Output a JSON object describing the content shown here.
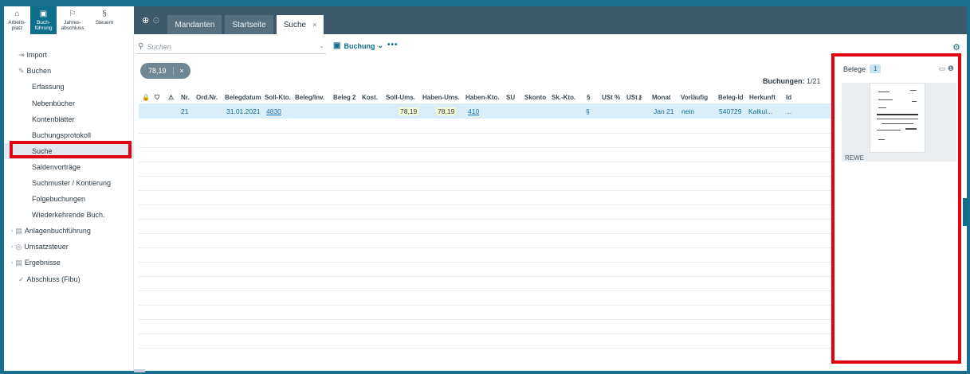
{
  "modules": [
    {
      "icon": "home-icon",
      "glyph": "⌂",
      "label_1": "Arbeits-",
      "label_2": "platz"
    },
    {
      "icon": "ledger-icon",
      "glyph": "▣",
      "label_1": "Buch-",
      "label_2": "führung"
    },
    {
      "icon": "flag-icon",
      "glyph": "⚐",
      "label_1": "Jahres-",
      "label_2": "abschluss"
    },
    {
      "icon": "paragraph-icon",
      "glyph": "§",
      "label_1": "Steuern",
      "label_2": ""
    }
  ],
  "tabs": [
    {
      "label": "Mandanten"
    },
    {
      "label": "Startseite"
    },
    {
      "label": "Suche",
      "close": "×"
    }
  ],
  "tabbar_icons": {
    "add": "⊕",
    "history": "⊙"
  },
  "sidebar": {
    "items": [
      {
        "label": "Import",
        "glyph": "⇥"
      },
      {
        "label": "Buchen",
        "glyph": "✎"
      },
      {
        "label": "Erfassung"
      },
      {
        "label": "Nebenbücher"
      },
      {
        "label": "Kontenblätter"
      },
      {
        "label": "Buchungsprotokoll"
      },
      {
        "label": "Suche"
      },
      {
        "label": "Saldenvorträge"
      },
      {
        "label": "Suchmuster / Kontierung"
      },
      {
        "label": "Folgebuchungen"
      },
      {
        "label": "Wiederkehrende Buch."
      },
      {
        "label": "Anlagenbuchführung",
        "glyph": "▤",
        "caret": "›"
      },
      {
        "label": "Umsatzsteuer",
        "glyph": "◎",
        "caret": "›"
      },
      {
        "label": "Ergebnisse",
        "glyph": "▤",
        "caret": "›"
      },
      {
        "label": "Abschluss (Fibu)",
        "glyph": "✓"
      }
    ]
  },
  "search": {
    "placeholder": "Suchen",
    "chevron": "⌄"
  },
  "toolbar": {
    "buchung_label": "Buchung",
    "buchung_chevron": "⌄",
    "more": "•••",
    "settings": "⚙"
  },
  "filter_chip": {
    "value": "78,19",
    "close": "×"
  },
  "count": {
    "label": "Buchungen:",
    "value": "1/21"
  },
  "table": {
    "header_icons": [
      "🔒",
      "⛉",
      "⚠"
    ],
    "columns": [
      "Nr.",
      "Ord.Nr.",
      "Belegdatum",
      "Soll-Kto.",
      "Beleg/Inv.",
      "Beleg 2",
      "Kost.",
      "Soll-Ums.",
      "Haben-Ums.",
      "Haben-Kto.",
      "SU",
      "Skonto",
      "Sk.-Kto.",
      "§",
      "USt %",
      "USt",
      "Monat",
      "Vorläufig",
      "Beleg-Id",
      "Herkunft",
      "Id"
    ],
    "rows": [
      {
        "nr": "21",
        "belegdatum": "31.01.2021",
        "soll_kto": "4830",
        "soll_ums": "78,19",
        "haben_ums": "78,19",
        "haben_kto": "410",
        "clip": "§",
        "monat": "Jan 21",
        "vorlaeufig": "nein",
        "beleg_id": "540729",
        "herkunft": "Kalkul...",
        "id": "..."
      }
    ]
  },
  "belege": {
    "title": "Belege",
    "count": "1",
    "icons": "▭ ❶",
    "thumb_label": "REWE"
  },
  "colors": {
    "accent": "#0f6e8c",
    "tabbar": "#3d5a6c",
    "highlight": "#e3000f",
    "selected_row": "#d9eef8"
  }
}
